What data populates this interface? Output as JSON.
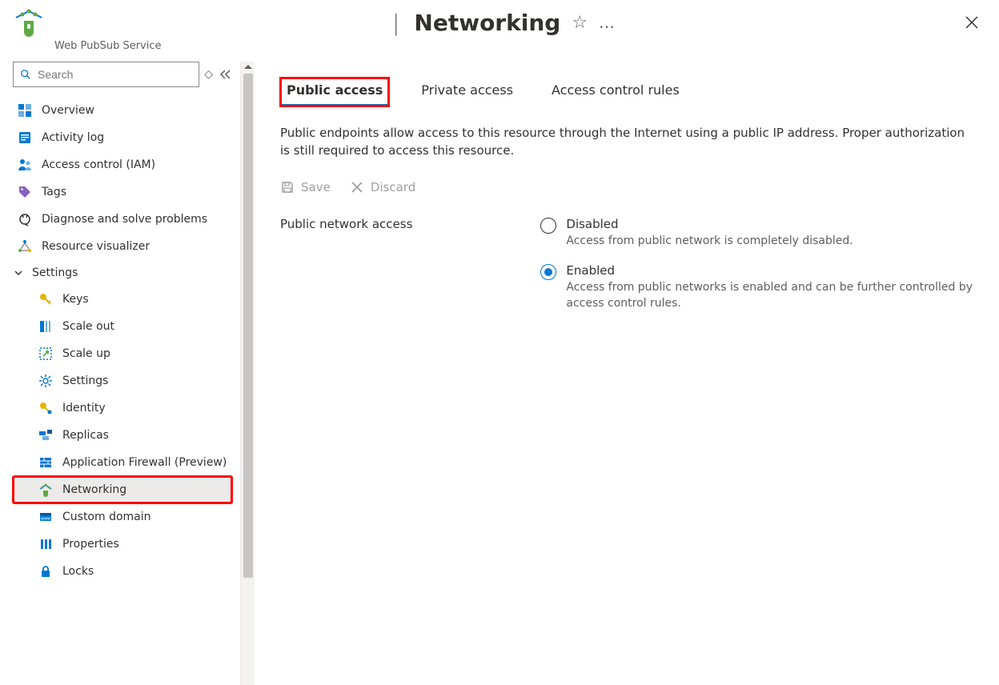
{
  "header": {
    "bar": "|",
    "title": "Networking",
    "service_label": "Web PubSub Service"
  },
  "search": {
    "placeholder": "Search"
  },
  "nav": {
    "items": [
      {
        "label": "Overview"
      },
      {
        "label": "Activity log"
      },
      {
        "label": "Access control (IAM)"
      },
      {
        "label": "Tags"
      },
      {
        "label": "Diagnose and solve problems"
      },
      {
        "label": "Resource visualizer"
      }
    ],
    "group": {
      "label": "Settings",
      "items": [
        {
          "label": "Keys"
        },
        {
          "label": "Scale out"
        },
        {
          "label": "Scale up"
        },
        {
          "label": "Settings"
        },
        {
          "label": "Identity"
        },
        {
          "label": "Replicas"
        },
        {
          "label": "Application Firewall (Preview)"
        },
        {
          "label": "Networking",
          "selected": true,
          "highlight": true
        },
        {
          "label": "Custom domain"
        },
        {
          "label": "Properties"
        },
        {
          "label": "Locks"
        }
      ]
    }
  },
  "tabs": [
    {
      "label": "Public access",
      "active": true,
      "highlight": true
    },
    {
      "label": "Private access"
    },
    {
      "label": "Access control rules"
    }
  ],
  "main": {
    "description": "Public endpoints allow access to this resource through the Internet using a public IP address. Proper authorization is still required to access this resource.",
    "save_label": "Save",
    "discard_label": "Discard",
    "field_label": "Public network access",
    "radio": {
      "selected": "enabled",
      "disabled_title": "Disabled",
      "disabled_sub": "Access from public network is completely disabled.",
      "enabled_title": "Enabled",
      "enabled_sub": "Access from public networks is enabled and can be further controlled by access control rules."
    }
  },
  "colors": {
    "accent": "#0078d4",
    "highlight": "#ff0000"
  }
}
